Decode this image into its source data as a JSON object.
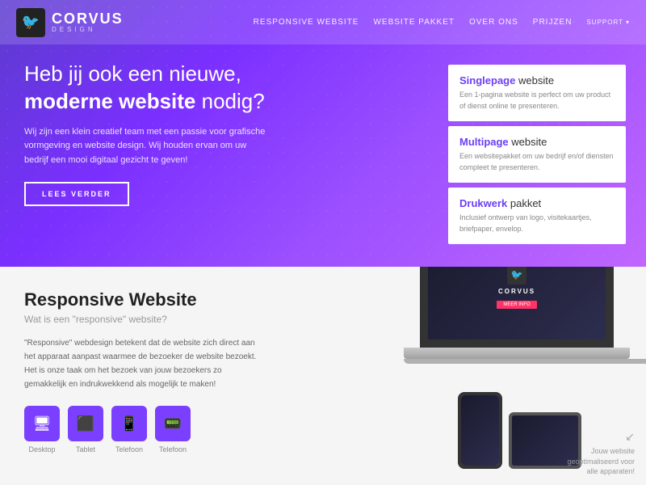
{
  "header": {
    "logo_main": "CorVUs",
    "logo_sub": "DESIGN",
    "logo_icon": "🐦",
    "nav": {
      "items": [
        {
          "label": "RESPONSIVE WEBSITE",
          "id": "nav-responsive"
        },
        {
          "label": "WEBSITE PAKKET",
          "id": "nav-pakket"
        },
        {
          "label": "OVER ONS",
          "id": "nav-over"
        },
        {
          "label": "PRIJZEN",
          "id": "nav-prijzen"
        },
        {
          "label": "SUPPORT",
          "id": "nav-support"
        }
      ]
    }
  },
  "hero": {
    "headline_normal": "Heb jij ook een nieuwe,",
    "headline_bold": "moderne website",
    "headline_end": " nodig?",
    "body": "Wij zijn een klein creatief team met een passie voor grafische vormgeving en website design. Wij houden ervan om uw bedrijf een mooi digitaal gezicht te geven!",
    "cta": "LEES VERDER",
    "cards": [
      {
        "title_bold": "Singlepage",
        "title_normal": " website",
        "desc": "Een 1-pagina website is perfect om uw product of dienst online te presenteren."
      },
      {
        "title_bold": "Multipage",
        "title_normal": " website",
        "desc": "Een websitepakket om uw bedrijf en/of diensten compleet te presenteren."
      },
      {
        "title_bold": "Drukwerk",
        "title_normal": " pakket",
        "desc": "Inclusief ontwerp van logo, visitekaartjes, briefpaper, envelop."
      }
    ]
  },
  "responsive_section": {
    "title": "Responsive Website",
    "subtitle": "Wat is een \"responsive\" website?",
    "body": "\"Responsive\" webdesign betekent dat de website zich direct aan het apparaat aanpast waarmee de bezoeker de website bezoekt. Het is onze taak om het bezoek van jouw bezoekers zo gemakkelijk en indrukwekkend als mogelijk te maken!",
    "devices": [
      {
        "label": "Desktop",
        "icon": "🖥"
      },
      {
        "label": "Tablet",
        "icon": "📱"
      },
      {
        "label": "Telefoon",
        "icon": "📱"
      },
      {
        "label": "Telefoon",
        "icon": "📟"
      }
    ],
    "mockup_caption": "Jouw website geoptimaliseerd voor alle apparaten!"
  }
}
